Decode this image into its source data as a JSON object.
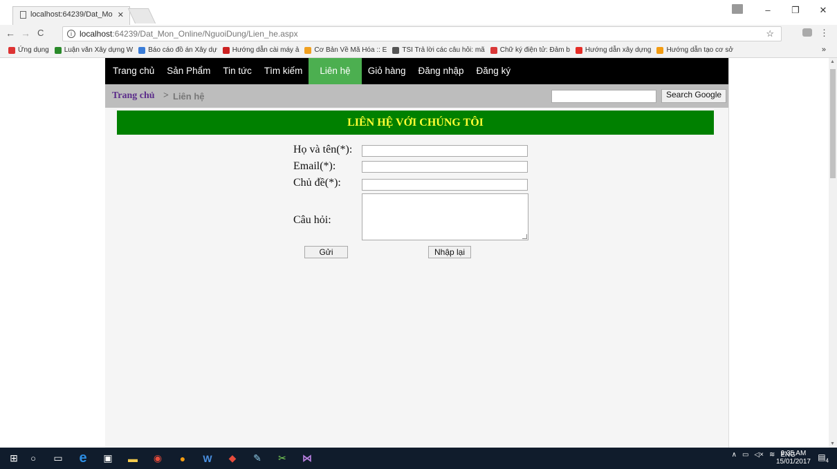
{
  "browser": {
    "tab_title": "localhost:64239/Dat_Mo",
    "url_host": "localhost",
    "url_rest": ":64239/Dat_Mon_Online/NguoiDung/Lien_he.aspx",
    "bookmarks": [
      {
        "label": "Ứng dụng",
        "color": "#d33"
      },
      {
        "label": "Luận văn Xây dựng W",
        "color": "#2a8a2a"
      },
      {
        "label": "Báo cáo đồ án Xây dự",
        "color": "#3b7dd8"
      },
      {
        "label": "Hướng dẫn cài máy ả",
        "color": "#cc2222"
      },
      {
        "label": "Cơ Bản Về Mã Hóa :: E",
        "color": "#f0a020"
      },
      {
        "label": "TSI Trả lời các câu hỏi: mã",
        "color": "#555"
      },
      {
        "label": "Chữ ký điện tử: Đảm b",
        "color": "#d93838"
      },
      {
        "label": "Hướng dẫn xây dựng",
        "color": "#e52d27"
      },
      {
        "label": "Hướng dẫn tạo cơ sở",
        "color": "#f39c12"
      }
    ],
    "bookmarks_more": "»"
  },
  "nav": {
    "items": [
      {
        "label": "Trang chủ",
        "active": false
      },
      {
        "label": "Sản Phẩm",
        "active": false
      },
      {
        "label": "Tin tức",
        "active": false
      },
      {
        "label": "Tìm kiếm",
        "active": false
      },
      {
        "label": "Liên hệ",
        "active": true
      },
      {
        "label": "Giỏ hàng",
        "active": false
      },
      {
        "label": "Đăng nhập",
        "active": false
      },
      {
        "label": "Đăng ký",
        "active": false
      }
    ]
  },
  "breadcrumb": {
    "home": "Trang chủ",
    "separator": ">",
    "current": "Liên hệ"
  },
  "search": {
    "value": "",
    "button": "Search Google"
  },
  "form": {
    "title": "LIÊN HỆ VỚI CHÚNG TÔI",
    "name_label": "Họ và tên(*):",
    "email_label": "Email(*):",
    "subject_label": "Chủ đề(*):",
    "question_label": "Câu hỏi:",
    "submit": "Gửi",
    "reset": "Nhập lại"
  },
  "taskbar": {
    "lang": "ENG",
    "time": "9:35 AM",
    "date": "15/01/2017",
    "notifications": "4"
  },
  "colors": {
    "nav_bg": "#000000",
    "nav_active": "#4caf50",
    "title_bg": "#008000",
    "title_text": "#ffff33",
    "breadcrumb_bg": "#bdbdbd"
  }
}
